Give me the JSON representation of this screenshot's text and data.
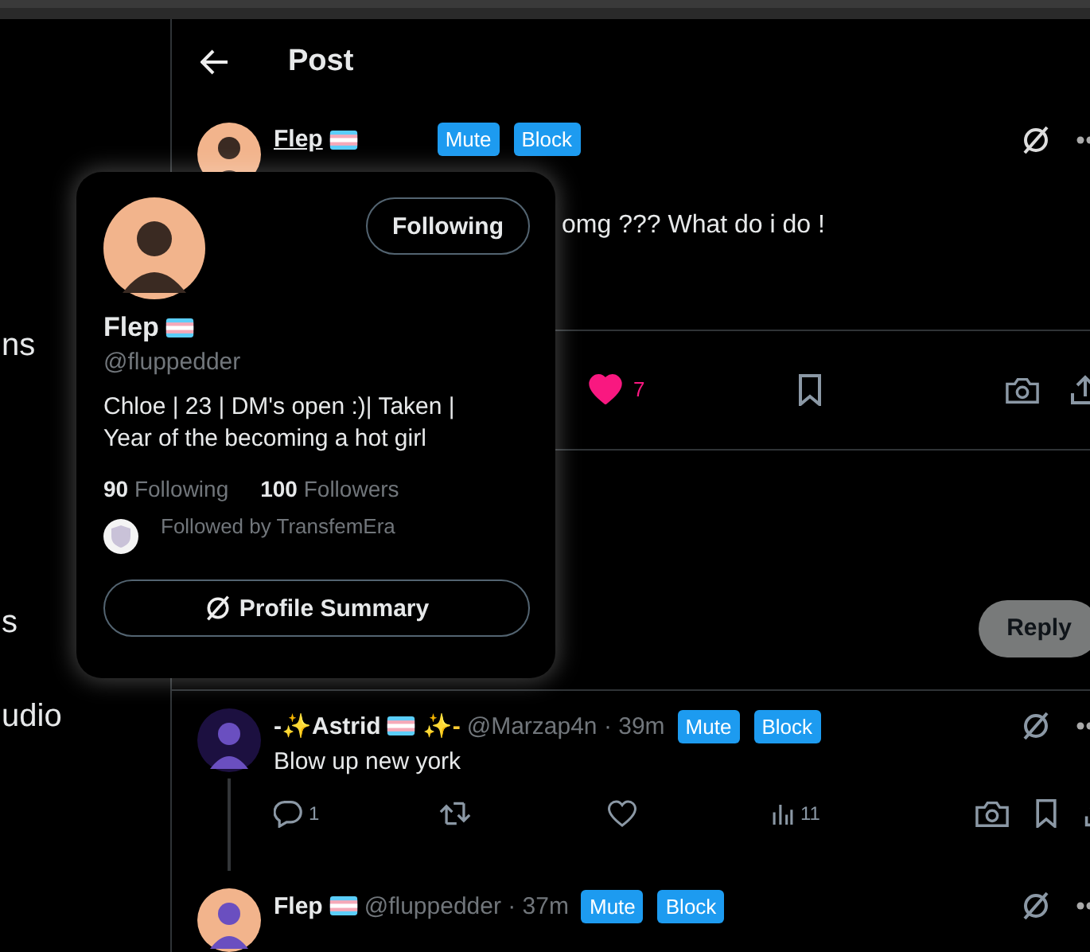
{
  "sidebar": {
    "items": [
      {
        "label": "ns"
      },
      {
        "label": "s"
      },
      {
        "label": "udio"
      }
    ]
  },
  "header": {
    "title": "Post"
  },
  "post": {
    "author": "Flep",
    "badges": [
      "Mute",
      "Block"
    ],
    "text": "omg ??? What do i do !",
    "likes": "7",
    "liked": true
  },
  "reply_button": "Reply",
  "replies": [
    {
      "name_start": "-✨Astrid",
      "name_end": "✨-",
      "meta": "@Marzap4n · 39m",
      "badges": [
        "Mute",
        "Block"
      ],
      "text": "Blow up new york",
      "reply_count": "1",
      "views": "11",
      "liked": false
    },
    {
      "name_start": "Flep",
      "meta": "@fluppedder · 37m",
      "badges": [
        "Mute",
        "Block"
      ]
    }
  ],
  "profile_card": {
    "following_button": "Following",
    "name": "Flep",
    "handle": "@fluppedder",
    "bio": "Chloe | 23 | DM's open :)| Taken | Year of the becoming a hot girl",
    "following_count": "90",
    "following_label": "Following",
    "followers_count": "100",
    "followers_label": "Followers",
    "followed_by": "Followed by TransfemEra",
    "summary_button": "Profile Summary"
  }
}
